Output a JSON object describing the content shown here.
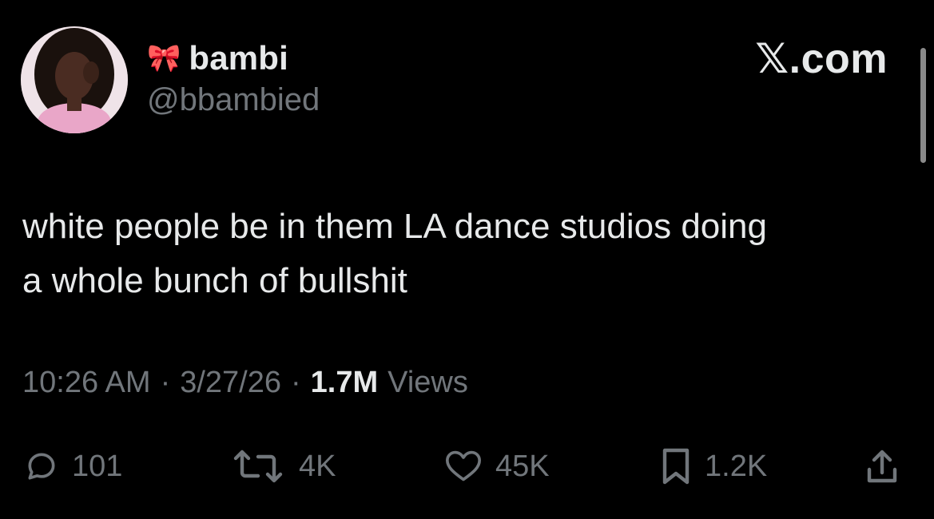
{
  "author": {
    "name_emoji": "🎀",
    "display_name": "bambi",
    "handle": "@bbambied"
  },
  "source_label": "𝕏.com",
  "tweet": {
    "text": "white people be in them LA dance studios doing\na whole bunch of bullshit"
  },
  "meta": {
    "time": "10:26 AM",
    "sep1": "·",
    "date": "3/27/26",
    "sep2": "·",
    "views_count": "1.7M",
    "views_label": "Views"
  },
  "actions": {
    "reply_count": "101",
    "retweet_count": "4K",
    "like_count": "45K",
    "bookmark_count": "1.2K"
  },
  "colors": {
    "background": "#000000",
    "primary_text": "#e7e9ea",
    "secondary_text": "#71767b"
  }
}
